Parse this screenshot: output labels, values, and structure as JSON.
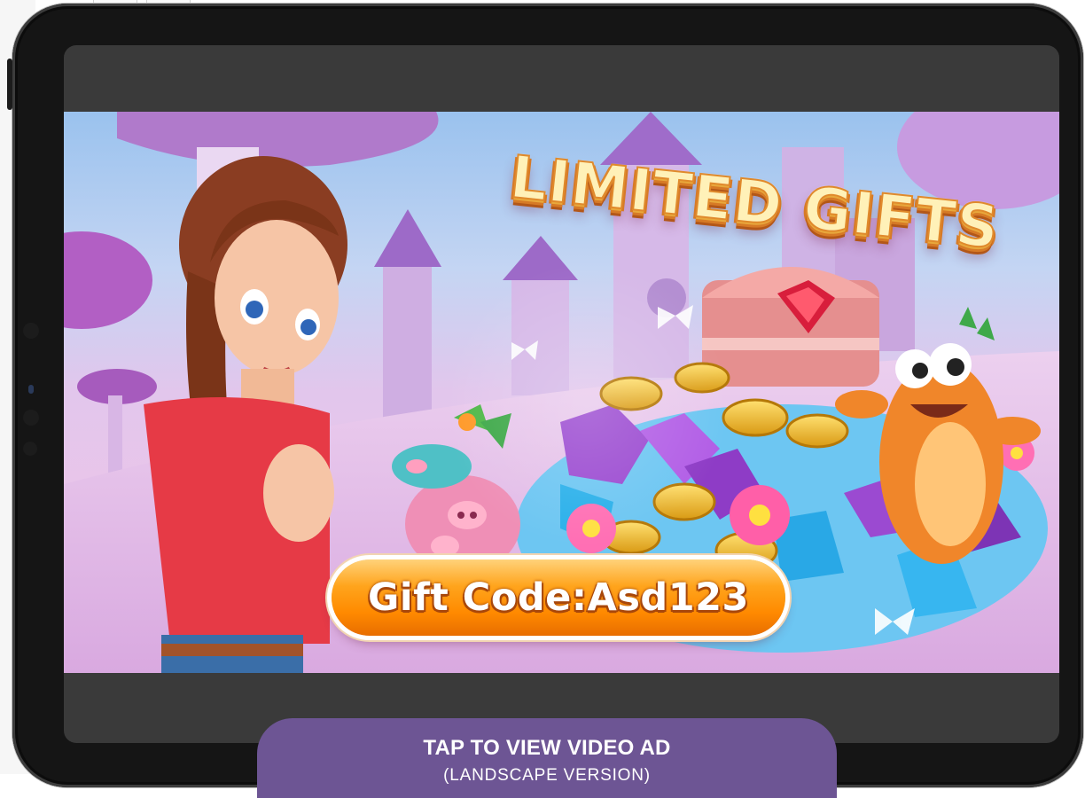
{
  "ad": {
    "headline": "LIMITED GIFTS",
    "gift_code": "Gift Code:Asd123"
  },
  "cta": {
    "title": "TAP TO VIEW VIDEO AD",
    "subtitle": "(LANDSCAPE VERSION)"
  },
  "colors": {
    "device_bezel": "#151515",
    "screen_background": "#3a3a3a",
    "cta_background": "#6d5594",
    "gift_pill": "#ff8a00",
    "headline": "#fff1b8"
  }
}
